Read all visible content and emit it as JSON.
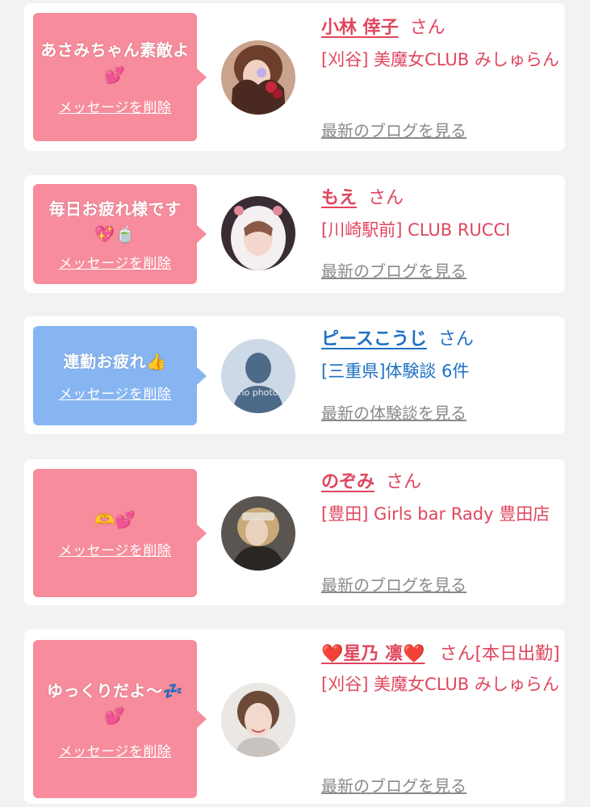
{
  "cards": [
    {
      "message": "あさみちゃん素敵よ💕",
      "delete_label": "メッセージを削除",
      "name": "小林 倖子",
      "honorific": "さん",
      "shop": "[刈谷] 美魔女CLUB みしゅらん",
      "more_link": "最新のブログを見る",
      "bubble_color": "#f68c9c"
    },
    {
      "message": "毎日お疲れ様です💖🍵",
      "delete_label": "メッセージを削除",
      "name": "もえ",
      "honorific": "さん",
      "shop": "[川崎駅前] CLUB RUCCI",
      "more_link": "最新のブログを見る",
      "bubble_color": "#f68c9c"
    },
    {
      "message": "連勤お疲れ👍",
      "delete_label": "メッセージを削除",
      "name": "ピースこうじ",
      "honorific": "さん",
      "shop": "[三重県]体験談 6件",
      "more_link": "最新の体験談を見る",
      "avatar_text": "no photo",
      "bubble_color": "#86b5f2"
    },
    {
      "message": "🫶💕",
      "delete_label": "メッセージを削除",
      "name": "のぞみ",
      "honorific": "さん",
      "shop": "[豊田] Girls bar Rady 豊田店",
      "more_link": "最新のブログを見る",
      "bubble_color": "#f68c9c"
    },
    {
      "message": "ゆっくりだよ〜💤💕",
      "delete_label": "メッセージを削除",
      "name": "❤️星乃 凛❤️",
      "honorific": "さん[本日出勤]",
      "shop": "[刈谷] 美魔女CLUB みしゅらん",
      "more_link": "最新のブログを見る",
      "bubble_color": "#f68c9c"
    }
  ],
  "colors": {
    "name_pink": "#e0465e",
    "name_blue": "#1f70c4",
    "link_gray": "#8a8a8a",
    "card_bg": "#ffffff",
    "page_bg": "#f2f2f2"
  }
}
